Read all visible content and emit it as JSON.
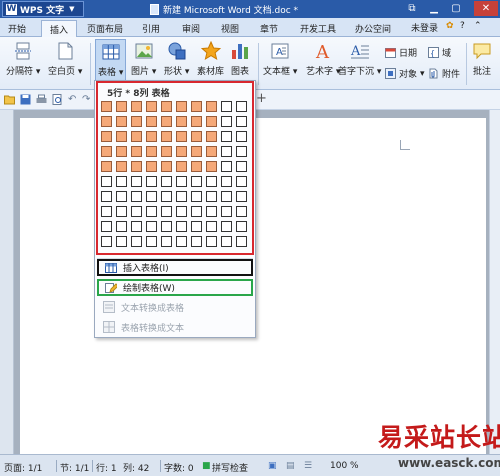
{
  "titlebar": {
    "app_name": "WPS 文字",
    "doc_title": "新建 Microsoft Word 文档.doc *"
  },
  "tabs": [
    "开始",
    "插入",
    "页面布局",
    "引用",
    "审阅",
    "视图",
    "章节",
    "开发工具",
    "办公空间"
  ],
  "active_tab": "插入",
  "login_label": "未登录",
  "ribbon": {
    "page_break": "分隔符",
    "blank_page": "空白页",
    "table": "表格",
    "picture": "图片",
    "shape": "形状",
    "material": "素材库",
    "chart": "图表",
    "textbox": "文本框",
    "wordart": "艺术字",
    "dropcap": "首字下沉",
    "date": "日期",
    "field": "域",
    "object": "对象",
    "attachment": "附件",
    "comment": "批注"
  },
  "table_menu": {
    "grid_caption": "5行 * 8列 表格",
    "grid_rows": 10,
    "grid_cols": 10,
    "selected_rows": 5,
    "selected_cols": 8,
    "insert_table": "插入表格(I)",
    "draw_table": "绘制表格(W)",
    "text_to_table": "文本转换成表格",
    "table_to_text": "表格转换成文本"
  },
  "statusbar": {
    "page": "页面: 1/1",
    "section": "节: 1/1",
    "row": "行: 1",
    "col": "列: 42",
    "wordcount": "字数: 0",
    "spellcheck": "拼写检查",
    "zoom": "100 %"
  },
  "watermark": {
    "brand": "易采站长站",
    "url": "www.easck.com"
  },
  "colors": {
    "titlebar": "#2a5ba8",
    "selected_cell": "#f5a878",
    "highlight_red": "#d8282f",
    "highlight_green": "#2aa64a"
  }
}
